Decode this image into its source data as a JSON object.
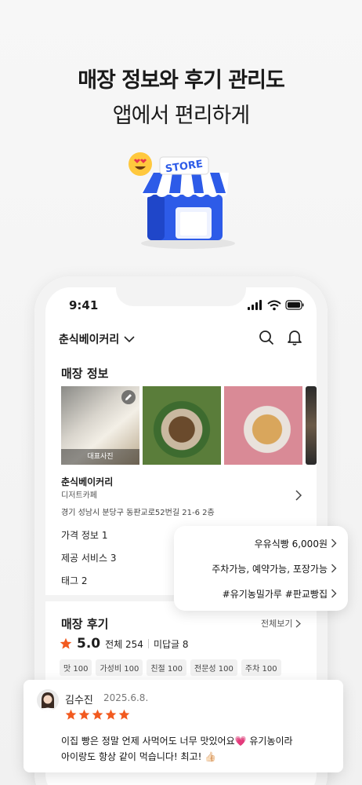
{
  "headline": {
    "line1": "매장 정보와 후기 관리도",
    "line2": "앱에서 편리하게"
  },
  "illustration": {
    "sign_text": "STORE",
    "emoji": "heart-eyes-emoji"
  },
  "status_bar": {
    "time": "9:41"
  },
  "app_bar": {
    "store_selector": "춘식베이커리"
  },
  "store_info": {
    "section_title": "매장 정보",
    "photo_badge": "대표사진",
    "name": "춘식베이커리",
    "category": "디저트카페",
    "address": "경기 성남시 분당구 동판교로52번길 21-6 2층",
    "rows": [
      {
        "label": "가격 정보",
        "count": "1"
      },
      {
        "label": "제공 서비스",
        "count": "3"
      },
      {
        "label": "태그",
        "count": "2"
      }
    ]
  },
  "popup": {
    "items": [
      "우유식빵 6,000원",
      "주차가능, 예약가능, 포장가능",
      "#유기농밀가루 #판교빵집"
    ]
  },
  "reviews": {
    "section_title": "매장 후기",
    "see_all": "전체보기",
    "rating": "5.0",
    "total": "전체 254",
    "unanswered": "미답글 8",
    "chips": [
      "맛 100",
      "가성비 100",
      "친절 100",
      "전문성 100",
      "주차 100"
    ],
    "card": {
      "name": "김수진",
      "date": "2025.6.8.",
      "stars": 5,
      "text_line1": "이집 빵은 정말 언제 사먹어도 너무 맛있어요💗 유기농이라",
      "text_line2": "아이랑도 항상 같이 먹습니다! 최고! 👍🏻"
    }
  },
  "colors": {
    "accent_orange": "#F25A1F",
    "store_blue": "#2B57E5"
  }
}
